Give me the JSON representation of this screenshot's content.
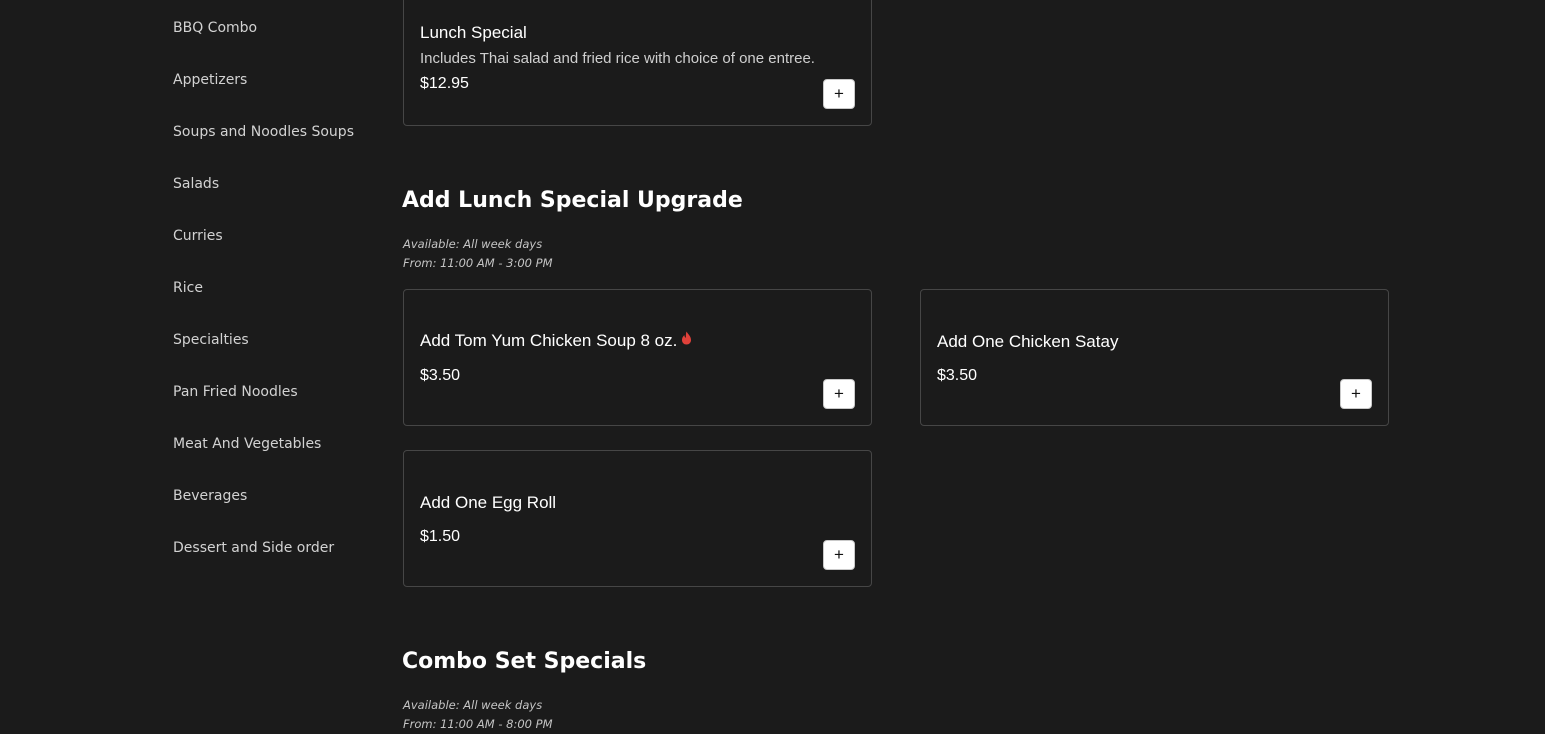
{
  "sidebar": {
    "items": [
      {
        "label": "BBQ Combo"
      },
      {
        "label": "Appetizers"
      },
      {
        "label": "Soups and Noodles Soups"
      },
      {
        "label": "Salads"
      },
      {
        "label": "Curries"
      },
      {
        "label": "Rice"
      },
      {
        "label": "Specialties"
      },
      {
        "label": "Pan Fried Noodles"
      },
      {
        "label": "Meat And Vegetables"
      },
      {
        "label": "Beverages"
      },
      {
        "label": "Dessert and Side order"
      }
    ]
  },
  "lunch_special_card": {
    "title": "Lunch Special",
    "description": "Includes Thai salad and fried rice with choice of one entree.",
    "price": "$12.95",
    "add_label": "+"
  },
  "upgrade_section": {
    "title": "Add Lunch Special Upgrade",
    "available": "Available: All week days",
    "hours": "From: 11:00 AM - 3:00 PM",
    "items": [
      {
        "title": "Add Tom Yum Chicken Soup 8 oz.",
        "price": "$3.50",
        "spicy": true,
        "add_label": "+"
      },
      {
        "title": "Add One Chicken Satay",
        "price": "$3.50",
        "spicy": false,
        "add_label": "+"
      },
      {
        "title": "Add One Egg Roll",
        "price": "$1.50",
        "spicy": false,
        "add_label": "+"
      }
    ]
  },
  "combo_section": {
    "title": "Combo Set Specials",
    "available": "Available: All week days",
    "hours": "From: 11:00 AM - 8:00 PM"
  },
  "icons": {
    "spicy": "flame-icon",
    "add": "plus-icon"
  },
  "colors": {
    "background": "#1b1b1b",
    "card_border": "#464646",
    "spicy": "#e0413a"
  }
}
